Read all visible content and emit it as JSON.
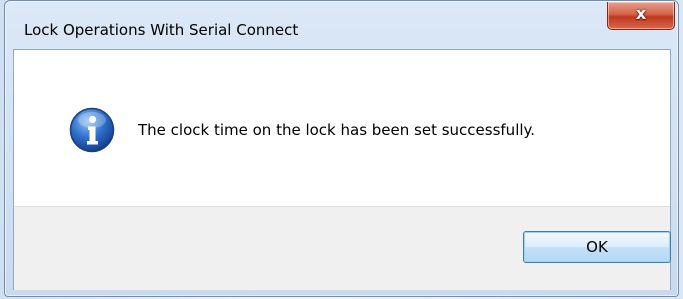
{
  "dialog": {
    "title": "Lock Operations With Serial Connect",
    "close_icon": "close-x-icon",
    "close_glyph": "x",
    "message": "The clock time on the lock has been set successfully.",
    "message_icon": "information-icon",
    "ok_label": "OK"
  },
  "colors": {
    "close_button": "#c7412a",
    "ok_border": "#3c7fb1",
    "info_icon": "#2a63b8",
    "footer": "#f0f0f0"
  }
}
